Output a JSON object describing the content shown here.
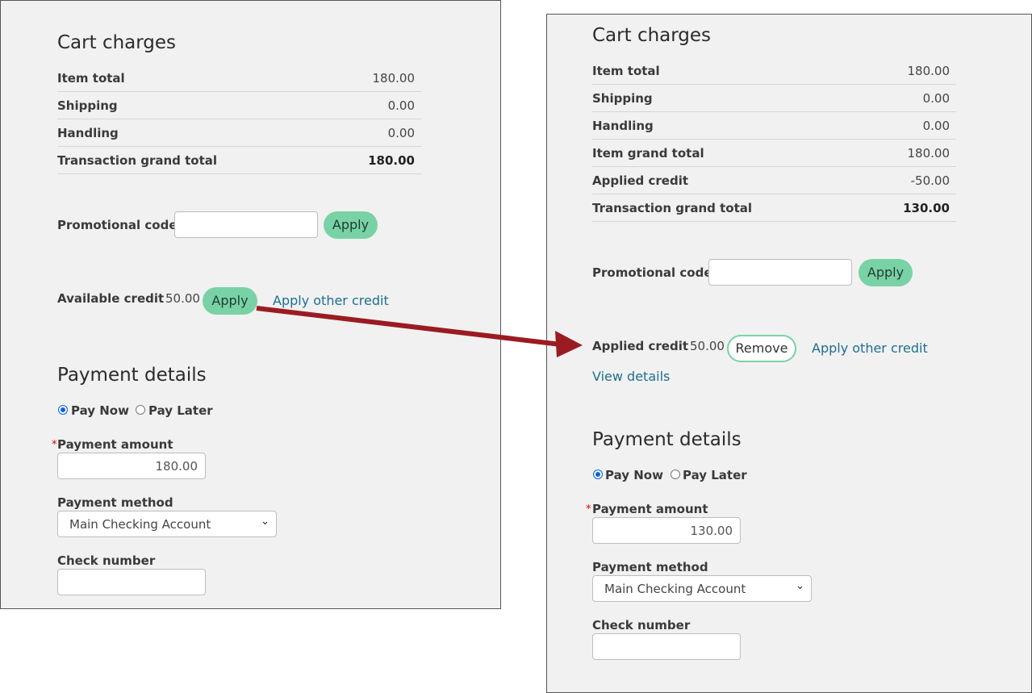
{
  "left": {
    "cart_title": "Cart charges",
    "rows": [
      {
        "label": "Item total",
        "value": "180.00",
        "bold": false
      },
      {
        "label": "Shipping",
        "value": "0.00",
        "bold": false
      },
      {
        "label": "Handling",
        "value": "0.00",
        "bold": false
      },
      {
        "label": "Transaction grand total",
        "value": "180.00",
        "bold": true
      }
    ],
    "promo_label": "Promotional code",
    "promo_value": "",
    "promo_apply": "Apply",
    "credit_label": "Available credit",
    "credit_amount": "50.00",
    "credit_apply": "Apply",
    "other_credit_link": "Apply other credit",
    "payment_title": "Payment details",
    "pay_now": "Pay Now",
    "pay_later": "Pay Later",
    "required_mark": "*",
    "payment_amount_label": "Payment amount",
    "payment_amount_value": "180.00",
    "payment_method_label": "Payment method",
    "payment_method_value": "Main Checking Account",
    "check_number_label": "Check number",
    "check_number_value": ""
  },
  "right": {
    "cart_title": "Cart charges",
    "rows": [
      {
        "label": "Item total",
        "value": "180.00",
        "bold": false
      },
      {
        "label": "Shipping",
        "value": "0.00",
        "bold": false
      },
      {
        "label": "Handling",
        "value": "0.00",
        "bold": false
      },
      {
        "label": "Item grand total",
        "value": "180.00",
        "bold": false
      },
      {
        "label": "Applied credit",
        "value": "-50.00",
        "bold": false
      },
      {
        "label": "Transaction grand total",
        "value": "130.00",
        "bold": true
      }
    ],
    "promo_label": "Promotional code",
    "promo_value": "",
    "promo_apply": "Apply",
    "applied_credit_label": "Applied credit",
    "applied_credit_amount": "50.00",
    "remove_button": "Remove",
    "other_credit_link": "Apply other credit",
    "view_details_link": "View details",
    "payment_title": "Payment details",
    "pay_now": "Pay Now",
    "pay_later": "Pay Later",
    "required_mark": "*",
    "payment_amount_label": "Payment amount",
    "payment_amount_value": "130.00",
    "payment_method_label": "Payment method",
    "payment_method_value": "Main Checking Account",
    "check_number_label": "Check number",
    "check_number_value": ""
  },
  "annotation": {
    "arrow_color": "#9b1b22",
    "accent_green": "#79d2a6",
    "link_color": "#1d6f8f"
  }
}
